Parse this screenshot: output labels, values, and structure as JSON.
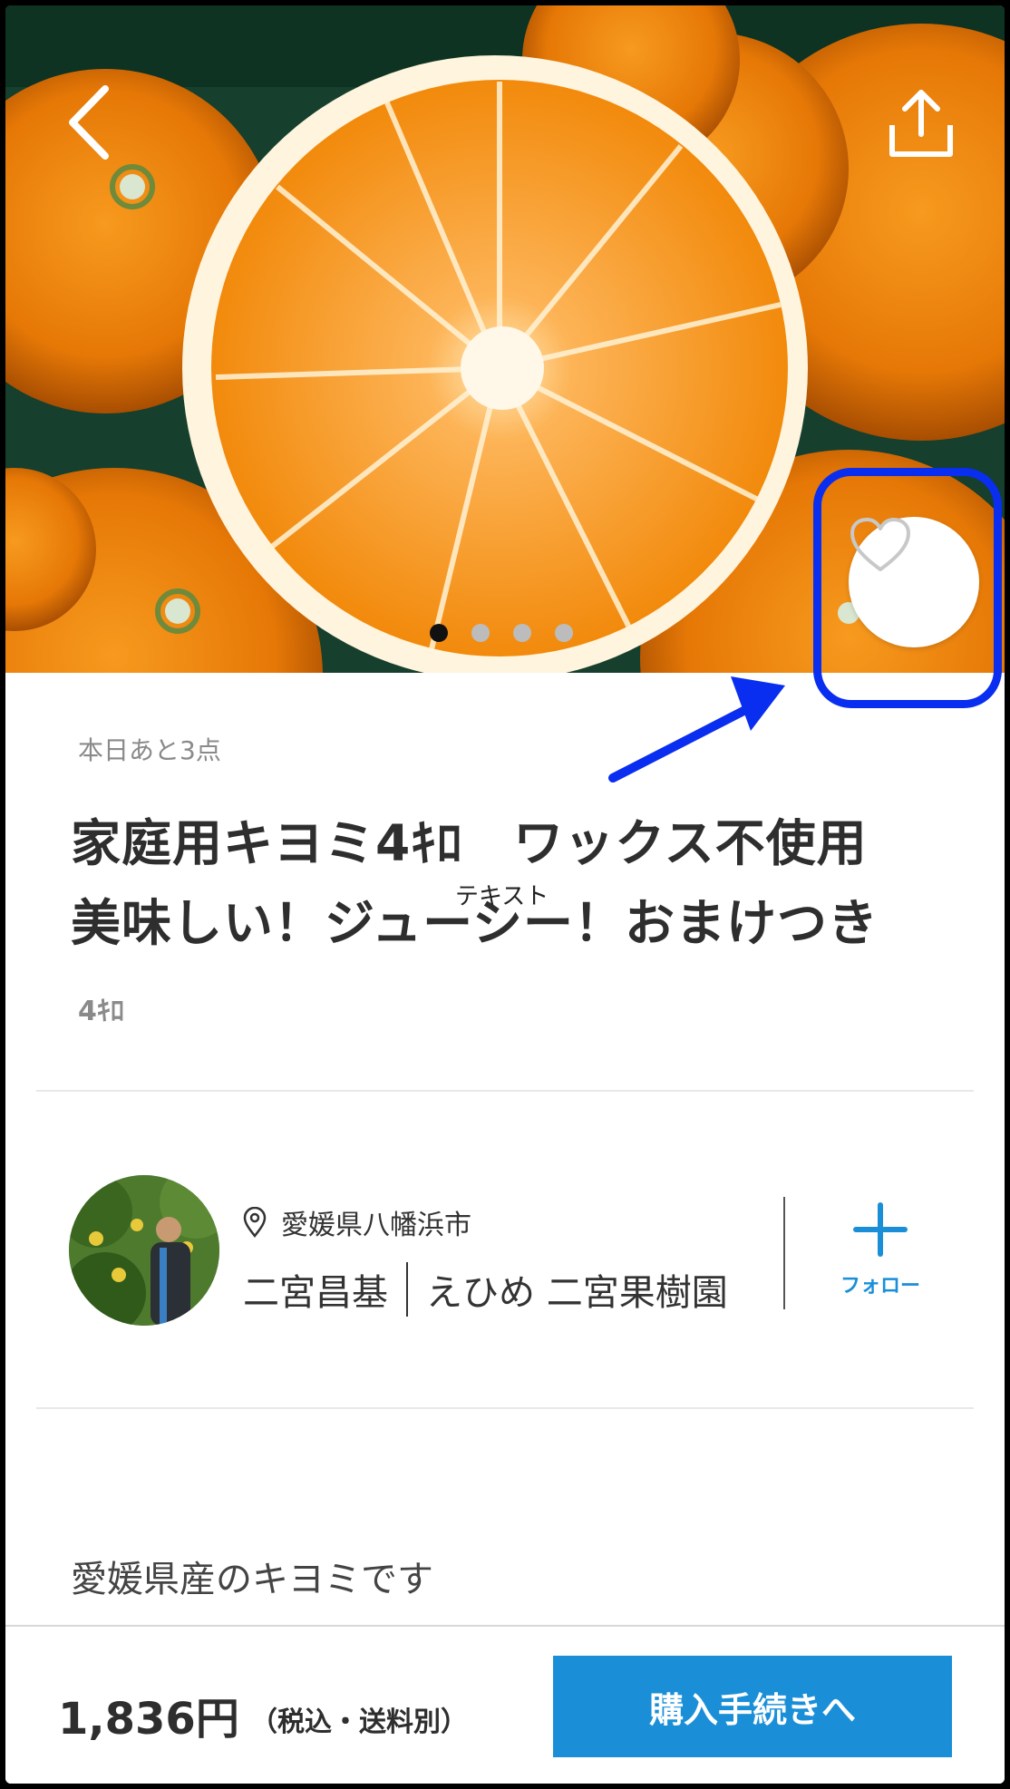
{
  "product": {
    "stock_note": "本日あと3点",
    "title_line1": "家庭用キヨミ4ｷﾛ　ワックス不使用",
    "title_line2": "美味しい！ジューシー！おまけつき",
    "weight": "4ｷﾛ"
  },
  "annotation": {
    "overlay_text": "テキスト",
    "highlight_color": "#0a2ef0"
  },
  "carousel": {
    "total_slides": 4,
    "active_index": 0
  },
  "producer": {
    "location": "愛媛県八幡浜市",
    "name": "二宮昌基",
    "farm": "えひめ 二宮果樹園",
    "follow_label": "フォロー"
  },
  "description": {
    "line1": "愛媛県産のキヨミです"
  },
  "purchase": {
    "price": "1,836円",
    "price_note": "（税込・送料別）",
    "button_label": "購入手続きへ"
  },
  "icons": {
    "back": "chevron-left-icon",
    "share": "share-icon",
    "favorite": "heart-icon",
    "location": "map-pin-icon",
    "follow": "plus-icon"
  },
  "colors": {
    "accent": "#1a8fd8",
    "annotation": "#0a2ef0",
    "orange": "#f08a10"
  }
}
